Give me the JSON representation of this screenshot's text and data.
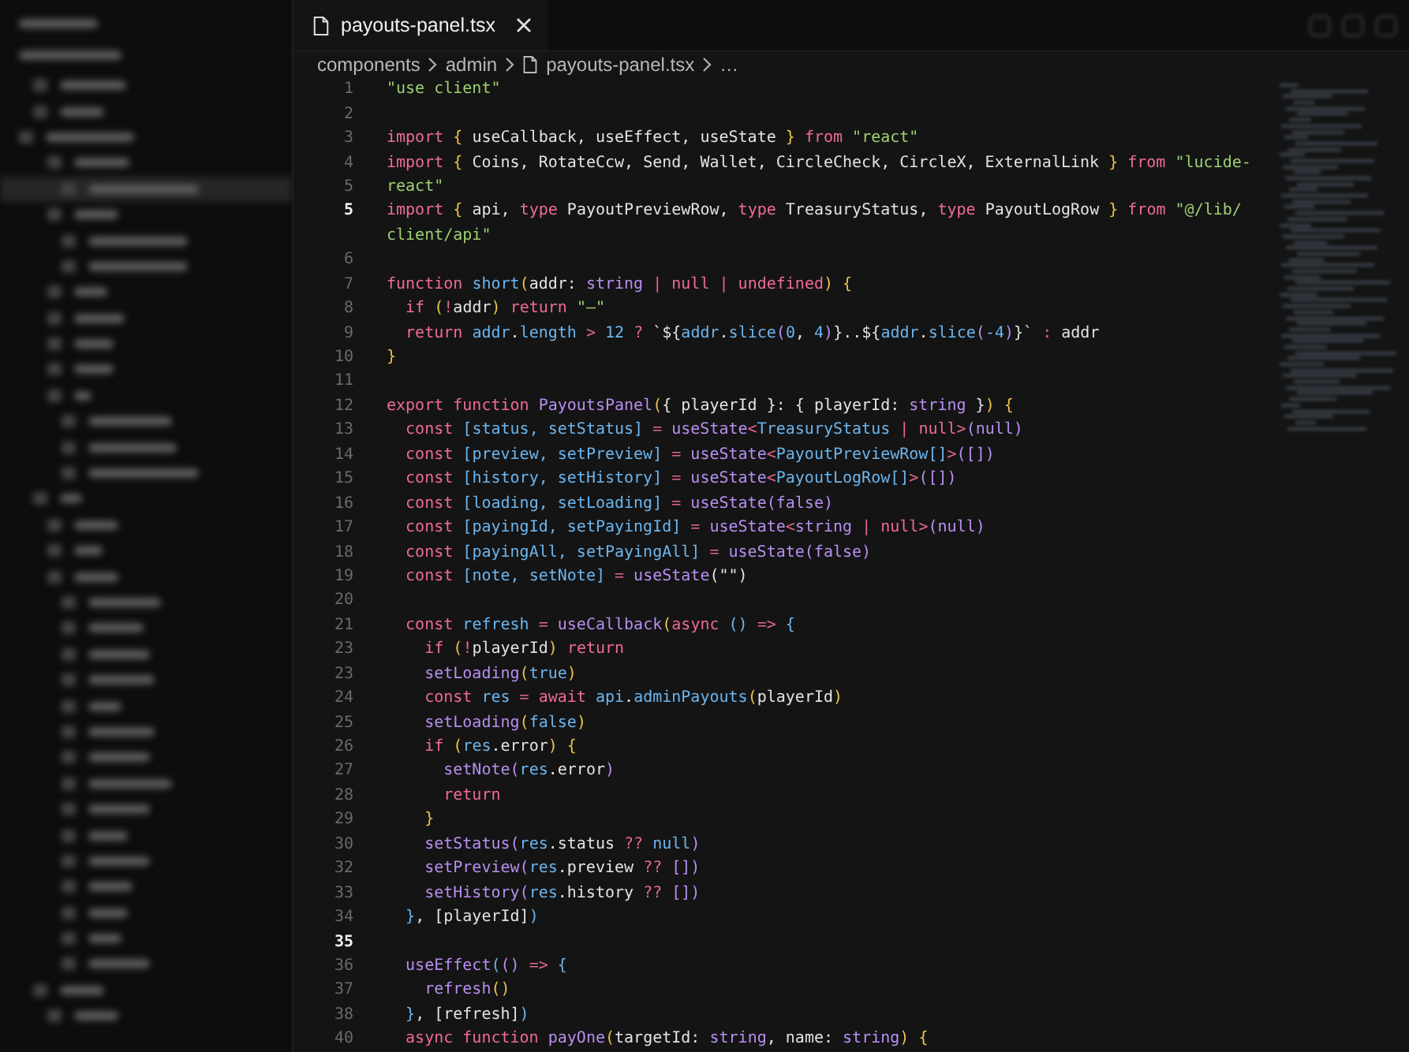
{
  "tab": {
    "label": "payouts-panel.tsx",
    "selected": true
  },
  "breadcrumb": {
    "folders": [
      "components",
      "admin"
    ],
    "file": "payouts-panel.tsx",
    "more": "…"
  },
  "code": [
    {
      "number": "1",
      "active": false,
      "tokens": [
        {
          "kind": "str",
          "text": "\"use client\""
        }
      ]
    },
    {
      "number": "2",
      "active": false
    },
    {
      "number": "3",
      "active": false,
      "tokens": [
        {
          "kind": "kw",
          "text": "import "
        },
        {
          "kind": "brace",
          "text": "{ "
        },
        {
          "kind": "plain",
          "text": "useCallback, useEffect, useState "
        },
        {
          "kind": "brace",
          "text": "} "
        },
        {
          "kind": "kw",
          "text": "from "
        },
        {
          "kind": "str",
          "text": "\"react\""
        }
      ]
    },
    {
      "number": "4",
      "active": false,
      "tokens": [
        {
          "kind": "kw",
          "text": "import "
        },
        {
          "kind": "brace",
          "text": "{ "
        },
        {
          "kind": "plain",
          "text": "Coins, RotateCcw, Send, Wallet, CircleCheck, CircleX, ExternalLink "
        },
        {
          "kind": "brace",
          "text": "} "
        },
        {
          "kind": "kw",
          "text": "from "
        },
        {
          "kind": "str",
          "text": "\"lucide-"
        }
      ]
    },
    {
      "number": "5",
      "active": false,
      "tokens": [
        {
          "kind": "str",
          "text": "react\""
        }
      ]
    },
    {
      "number": "5",
      "active": true,
      "tokens": [
        {
          "kind": "kw",
          "text": "import "
        },
        {
          "kind": "brace",
          "text": "{ "
        },
        {
          "kind": "plain",
          "text": "api, "
        },
        {
          "kind": "kw",
          "text": "type "
        },
        {
          "kind": "plain",
          "text": "PayoutPreviewRow, "
        },
        {
          "kind": "kw",
          "text": "type "
        },
        {
          "kind": "plain",
          "text": "TreasuryStatus, "
        },
        {
          "kind": "kw",
          "text": "type "
        },
        {
          "kind": "plain",
          "text": "PayoutLogRow "
        },
        {
          "kind": "brace",
          "text": "} "
        },
        {
          "kind": "kw",
          "text": "from "
        },
        {
          "kind": "str",
          "text": "\"@/lib/"
        }
      ]
    },
    {
      "tokens": [
        {
          "kind": "str",
          "text": "client/api\""
        }
      ]
    },
    {
      "number": "6",
      "active": false
    },
    {
      "number": "7",
      "active": false,
      "tokens": [
        {
          "kind": "kw",
          "text": "function "
        },
        {
          "kind": "var",
          "text": "short"
        },
        {
          "kind": "brace",
          "text": "("
        },
        {
          "kind": "plain",
          "text": "addr: "
        },
        {
          "kind": "fn",
          "text": "string"
        },
        {
          "kind": "op",
          "text": " | "
        },
        {
          "kind": "kw",
          "text": "null"
        },
        {
          "kind": "op",
          "text": " | "
        },
        {
          "kind": "kw",
          "text": "undefined"
        },
        {
          "kind": "brace",
          "text": ") {"
        }
      ]
    },
    {
      "number": "8",
      "active": false,
      "tokens": [
        {
          "kind": "kw",
          "text": "  if "
        },
        {
          "kind": "brace",
          "text": "("
        },
        {
          "kind": "op",
          "text": "!"
        },
        {
          "kind": "plain",
          "text": "addr"
        },
        {
          "kind": "brace",
          "text": ") "
        },
        {
          "kind": "kw",
          "text": "return "
        },
        {
          "kind": "str",
          "text": "\"—\""
        }
      ]
    },
    {
      "number": "9",
      "active": false,
      "tokens": [
        {
          "kind": "kw",
          "text": "  return "
        },
        {
          "kind": "var",
          "text": "addr"
        },
        {
          "kind": "plain",
          "text": "."
        },
        {
          "kind": "var",
          "text": "length"
        },
        {
          "kind": "op",
          "text": " > "
        },
        {
          "kind": "var",
          "text": "12"
        },
        {
          "kind": "op",
          "text": " ? "
        },
        {
          "kind": "plain",
          "text": "`${"
        },
        {
          "kind": "var",
          "text": "addr"
        },
        {
          "kind": "plain",
          "text": "."
        },
        {
          "kind": "var",
          "text": "slice"
        },
        {
          "kind": "fn",
          "text": "("
        },
        {
          "kind": "var",
          "text": "0"
        },
        {
          "kind": "plain",
          "text": ", "
        },
        {
          "kind": "var",
          "text": "4"
        },
        {
          "kind": "fn",
          "text": ")"
        },
        {
          "kind": "plain",
          "text": "}..${"
        },
        {
          "kind": "var",
          "text": "addr"
        },
        {
          "kind": "plain",
          "text": "."
        },
        {
          "kind": "var",
          "text": "slice"
        },
        {
          "kind": "fn",
          "text": "("
        },
        {
          "kind": "var",
          "text": "-4"
        },
        {
          "kind": "fn",
          "text": ")"
        },
        {
          "kind": "plain",
          "text": "}`"
        },
        {
          "kind": "op",
          "text": " : "
        },
        {
          "kind": "plain",
          "text": "addr"
        }
      ]
    },
    {
      "number": "10",
      "active": false,
      "tokens": [
        {
          "kind": "brace",
          "text": "}"
        }
      ]
    },
    {
      "number": "11",
      "active": false
    },
    {
      "number": "12",
      "active": false,
      "tokens": [
        {
          "kind": "kw",
          "text": "export function "
        },
        {
          "kind": "fn",
          "text": "PayoutsPanel"
        },
        {
          "kind": "brace",
          "text": "("
        },
        {
          "kind": "plain",
          "text": "{ playerId }: { playerId: "
        },
        {
          "kind": "fn",
          "text": "string"
        },
        {
          "kind": "plain",
          "text": " }"
        },
        {
          "kind": "brace",
          "text": ") {"
        }
      ]
    },
    {
      "number": "13",
      "active": false,
      "tokens": [
        {
          "kind": "kw",
          "text": "  const "
        },
        {
          "kind": "var",
          "text": "[status, setStatus]"
        },
        {
          "kind": "op",
          "text": " = "
        },
        {
          "kind": "fn",
          "text": "useState"
        },
        {
          "kind": "op",
          "text": "<"
        },
        {
          "kind": "var",
          "text": "TreasuryStatus"
        },
        {
          "kind": "op",
          "text": " | "
        },
        {
          "kind": "kw",
          "text": "null"
        },
        {
          "kind": "op",
          "text": ">"
        },
        {
          "kind": "fn",
          "text": "(null)"
        }
      ]
    },
    {
      "number": "14",
      "active": false,
      "tokens": [
        {
          "kind": "kw",
          "text": "  const "
        },
        {
          "kind": "var",
          "text": "[preview, setPreview]"
        },
        {
          "kind": "op",
          "text": " = "
        },
        {
          "kind": "fn",
          "text": "useState"
        },
        {
          "kind": "op",
          "text": "<"
        },
        {
          "kind": "var",
          "text": "PayoutPreviewRow[]"
        },
        {
          "kind": "op",
          "text": ">"
        },
        {
          "kind": "fn",
          "text": "([])"
        }
      ]
    },
    {
      "number": "15",
      "active": false,
      "tokens": [
        {
          "kind": "kw",
          "text": "  const "
        },
        {
          "kind": "var",
          "text": "[history, setHistory]"
        },
        {
          "kind": "op",
          "text": " = "
        },
        {
          "kind": "fn",
          "text": "useState"
        },
        {
          "kind": "op",
          "text": "<"
        },
        {
          "kind": "var",
          "text": "PayoutLogRow[]"
        },
        {
          "kind": "op",
          "text": ">"
        },
        {
          "kind": "fn",
          "text": "([])"
        }
      ]
    },
    {
      "number": "16",
      "active": false,
      "tokens": [
        {
          "kind": "kw",
          "text": "  const "
        },
        {
          "kind": "var",
          "text": "[loading, setLoading]"
        },
        {
          "kind": "op",
          "text": " = "
        },
        {
          "kind": "fn",
          "text": "useState(false)"
        }
      ]
    },
    {
      "number": "17",
      "active": false,
      "tokens": [
        {
          "kind": "kw",
          "text": "  const "
        },
        {
          "kind": "var",
          "text": "[payingId, setPayingId]"
        },
        {
          "kind": "op",
          "text": " = "
        },
        {
          "kind": "fn",
          "text": "useState"
        },
        {
          "kind": "op",
          "text": "<"
        },
        {
          "kind": "fn",
          "text": "string"
        },
        {
          "kind": "op",
          "text": " | "
        },
        {
          "kind": "kw",
          "text": "null"
        },
        {
          "kind": "op",
          "text": ">"
        },
        {
          "kind": "fn",
          "text": "(null)"
        }
      ]
    },
    {
      "number": "18",
      "active": false,
      "tokens": [
        {
          "kind": "kw",
          "text": "  const "
        },
        {
          "kind": "var",
          "text": "[payingAll, setPayingAll]"
        },
        {
          "kind": "op",
          "text": " = "
        },
        {
          "kind": "fn",
          "text": "useState(false)"
        }
      ]
    },
    {
      "number": "19",
      "active": false,
      "tokens": [
        {
          "kind": "kw",
          "text": "  const "
        },
        {
          "kind": "var",
          "text": "[note, setNote]"
        },
        {
          "kind": "op",
          "text": " = "
        },
        {
          "kind": "fn",
          "text": "useState"
        },
        {
          "kind": "plain",
          "text": "(\"\")"
        }
      ]
    },
    {
      "number": "20",
      "active": false
    },
    {
      "number": "21",
      "active": false,
      "tokens": [
        {
          "kind": "kw",
          "text": "  const "
        },
        {
          "kind": "var",
          "text": "refresh"
        },
        {
          "kind": "op",
          "text": " = "
        },
        {
          "kind": "fn",
          "text": "useCallback"
        },
        {
          "kind": "brace",
          "text": "("
        },
        {
          "kind": "kw",
          "text": "async "
        },
        {
          "kind": "var",
          "text": "()"
        },
        {
          "kind": "op",
          "text": " => "
        },
        {
          "kind": "var",
          "text": "{"
        }
      ]
    },
    {
      "number": "23",
      "active": false,
      "tokens": [
        {
          "kind": "kw",
          "text": "    if "
        },
        {
          "kind": "brace",
          "text": "("
        },
        {
          "kind": "op",
          "text": "!"
        },
        {
          "kind": "plain",
          "text": "playerId"
        },
        {
          "kind": "brace",
          "text": ") "
        },
        {
          "kind": "kw",
          "text": "return"
        }
      ]
    },
    {
      "number": "23",
      "active": false,
      "tokens": [
        {
          "kind": "fn",
          "text": "    setLoading"
        },
        {
          "kind": "brace",
          "text": "("
        },
        {
          "kind": "var",
          "text": "true"
        },
        {
          "kind": "brace",
          "text": ")"
        }
      ]
    },
    {
      "number": "24",
      "active": false,
      "tokens": [
        {
          "kind": "kw",
          "text": "    const "
        },
        {
          "kind": "var",
          "text": "res"
        },
        {
          "kind": "op",
          "text": " = "
        },
        {
          "kind": "kw",
          "text": "await "
        },
        {
          "kind": "var",
          "text": "api"
        },
        {
          "kind": "plain",
          "text": "."
        },
        {
          "kind": "var",
          "text": "adminPayouts"
        },
        {
          "kind": "brace",
          "text": "("
        },
        {
          "kind": "plain",
          "text": "playerId"
        },
        {
          "kind": "brace",
          "text": ")"
        }
      ]
    },
    {
      "number": "25",
      "active": false,
      "tokens": [
        {
          "kind": "fn",
          "text": "    setLoading"
        },
        {
          "kind": "brace",
          "text": "("
        },
        {
          "kind": "var",
          "text": "false"
        },
        {
          "kind": "brace",
          "text": ")"
        }
      ]
    },
    {
      "number": "26",
      "active": false,
      "tokens": [
        {
          "kind": "kw",
          "text": "    if "
        },
        {
          "kind": "brace",
          "text": "("
        },
        {
          "kind": "var",
          "text": "res"
        },
        {
          "kind": "plain",
          "text": ".error"
        },
        {
          "kind": "brace",
          "text": ") {"
        }
      ]
    },
    {
      "number": "27",
      "active": false,
      "tokens": [
        {
          "kind": "fn",
          "text": "      setNote("
        },
        {
          "kind": "var",
          "text": "res"
        },
        {
          "kind": "plain",
          "text": ".error"
        },
        {
          "kind": "fn",
          "text": ")"
        }
      ]
    },
    {
      "number": "28",
      "active": false,
      "tokens": [
        {
          "kind": "kw",
          "text": "      return"
        }
      ]
    },
    {
      "number": "29",
      "active": false,
      "tokens": [
        {
          "kind": "brace",
          "text": "    }"
        }
      ]
    },
    {
      "number": "30",
      "active": false,
      "tokens": [
        {
          "kind": "fn",
          "text": "    setStatus("
        },
        {
          "kind": "var",
          "text": "res"
        },
        {
          "kind": "plain",
          "text": ".status "
        },
        {
          "kind": "op",
          "text": "?? "
        },
        {
          "kind": "var",
          "text": "null"
        },
        {
          "kind": "fn",
          "text": ")"
        }
      ]
    },
    {
      "number": "32",
      "active": false,
      "tokens": [
        {
          "kind": "fn",
          "text": "    setPreview("
        },
        {
          "kind": "var",
          "text": "res"
        },
        {
          "kind": "plain",
          "text": ".preview "
        },
        {
          "kind": "op",
          "text": "?? "
        },
        {
          "kind": "fn",
          "text": "[])"
        }
      ]
    },
    {
      "number": "33",
      "active": false,
      "tokens": [
        {
          "kind": "fn",
          "text": "    setHistory("
        },
        {
          "kind": "var",
          "text": "res"
        },
        {
          "kind": "plain",
          "text": ".history "
        },
        {
          "kind": "op",
          "text": "?? "
        },
        {
          "kind": "fn",
          "text": "[])"
        }
      ]
    },
    {
      "number": "34",
      "active": false,
      "tokens": [
        {
          "kind": "var",
          "text": "  }"
        },
        {
          "kind": "plain",
          "text": ", [playerId]"
        },
        {
          "kind": "var",
          "text": ")"
        }
      ]
    },
    {
      "number": "35",
      "active": true
    },
    {
      "number": "36",
      "active": false,
      "tokens": [
        {
          "kind": "fn",
          "text": "  useEffect"
        },
        {
          "kind": "var",
          "text": "("
        },
        {
          "kind": "fn",
          "text": "()"
        },
        {
          "kind": "op",
          "text": " => "
        },
        {
          "kind": "var",
          "text": "{"
        }
      ]
    },
    {
      "number": "37",
      "active": false,
      "tokens": [
        {
          "kind": "fn",
          "text": "    refresh"
        },
        {
          "kind": "brace",
          "text": "()"
        }
      ]
    },
    {
      "number": "38",
      "active": false,
      "tokens": [
        {
          "kind": "var",
          "text": "  }"
        },
        {
          "kind": "plain",
          "text": ", [refresh]"
        },
        {
          "kind": "var",
          "text": ")"
        }
      ]
    },
    {
      "number": "40",
      "active": false,
      "tokens": [
        {
          "kind": "kw",
          "text": "  async function "
        },
        {
          "kind": "fn",
          "text": "payOne"
        },
        {
          "kind": "brace",
          "text": "("
        },
        {
          "kind": "plain",
          "text": "targetId: "
        },
        {
          "kind": "fn",
          "text": "string"
        },
        {
          "kind": "plain",
          "text": ", name: "
        },
        {
          "kind": "fn",
          "text": "string"
        },
        {
          "kind": "brace",
          "text": ") {"
        }
      ]
    }
  ]
}
